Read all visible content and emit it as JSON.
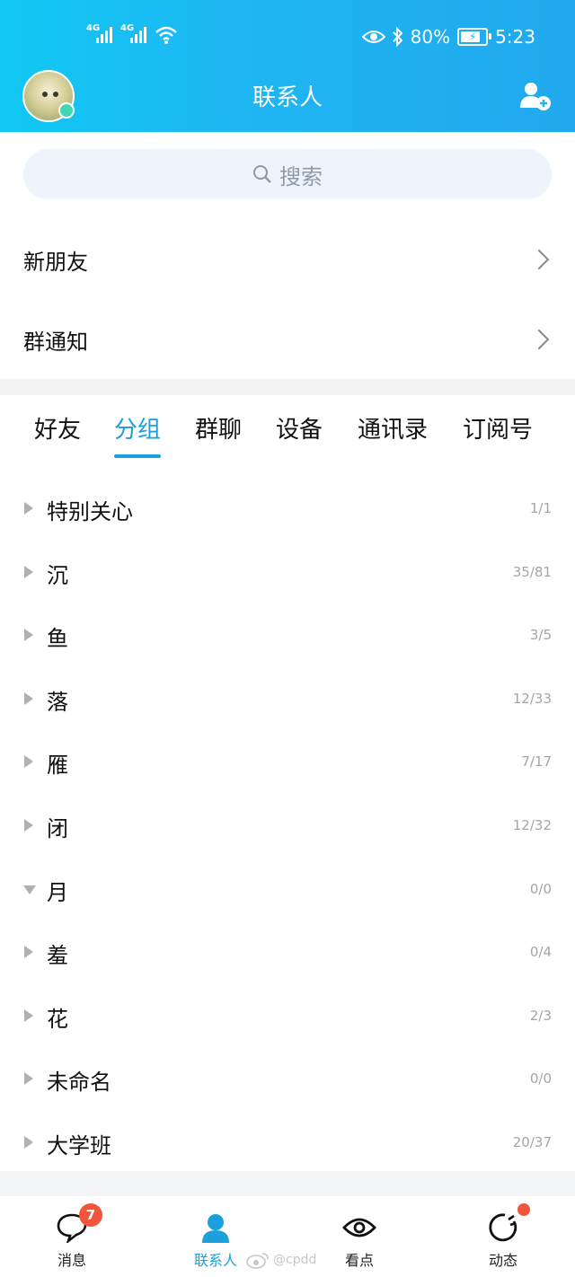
{
  "status_bar": {
    "signal1": "4G",
    "signal2": "4G",
    "battery": "80%",
    "battery_level": 0.8,
    "time": "5:23"
  },
  "header": {
    "title": "联系人"
  },
  "search": {
    "placeholder": "搜索"
  },
  "menu": [
    {
      "label": "新朋友"
    },
    {
      "label": "群通知"
    }
  ],
  "tabs": [
    {
      "label": "好友",
      "active": false
    },
    {
      "label": "分组",
      "active": true
    },
    {
      "label": "群聊",
      "active": false
    },
    {
      "label": "设备",
      "active": false
    },
    {
      "label": "通讯录",
      "active": false
    },
    {
      "label": "订阅号",
      "active": false
    }
  ],
  "groups": [
    {
      "name": "特别关心",
      "count": "1/1",
      "expanded": false
    },
    {
      "name": "沉",
      "count": "35/81",
      "expanded": false
    },
    {
      "name": "鱼",
      "count": "3/5",
      "expanded": false
    },
    {
      "name": "落",
      "count": "12/33",
      "expanded": false
    },
    {
      "name": "雁",
      "count": "7/17",
      "expanded": false
    },
    {
      "name": "闭",
      "count": "12/32",
      "expanded": false
    },
    {
      "name": "月",
      "count": "0/0",
      "expanded": true
    },
    {
      "name": "羞",
      "count": "0/4",
      "expanded": false
    },
    {
      "name": "花",
      "count": "2/3",
      "expanded": false
    },
    {
      "name": "未命名",
      "count": "0/0",
      "expanded": false
    },
    {
      "name": "大学班",
      "count": "20/37",
      "expanded": false
    }
  ],
  "bottom_nav": [
    {
      "label": "消息",
      "icon": "chat-bubble-icon",
      "badge": "7"
    },
    {
      "label": "联系人",
      "icon": "person-icon",
      "active": true
    },
    {
      "label": "看点",
      "icon": "eye-icon"
    },
    {
      "label": "动态",
      "icon": "star-circle-icon",
      "dot": true
    }
  ],
  "watermark": "@cpdd",
  "colors": {
    "accent": "#1aa0da",
    "header_start": "#11c8f2",
    "header_end": "#21a8ee",
    "badge": "#f0563c"
  }
}
